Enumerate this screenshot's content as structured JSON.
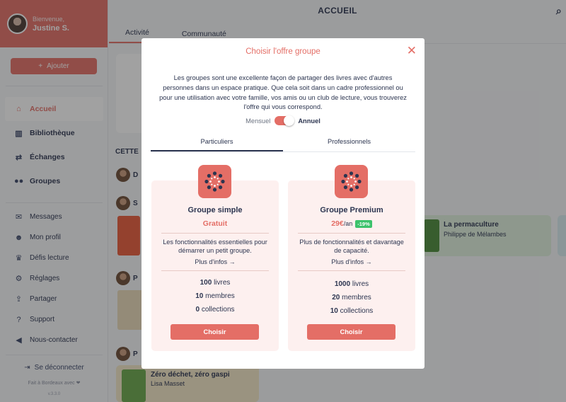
{
  "sidebar": {
    "greeting": "Bienvenue,",
    "user_name": "Justine S.",
    "add_label": "Ajouter",
    "main_items": [
      {
        "label": "Accueil",
        "icon": "home-icon",
        "active": true
      },
      {
        "label": "Bibliothèque",
        "icon": "books-icon"
      },
      {
        "label": "Échanges",
        "icon": "exchange-icon"
      },
      {
        "label": "Groupes",
        "icon": "group-icon"
      }
    ],
    "secondary_items": [
      {
        "label": "Messages",
        "icon": "mail-icon"
      },
      {
        "label": "Mon profil",
        "icon": "user-icon"
      },
      {
        "label": "Défis lecture",
        "icon": "trophy-icon"
      },
      {
        "label": "Réglages",
        "icon": "gear-icon"
      },
      {
        "label": "Partager",
        "icon": "share-icon"
      },
      {
        "label": "Support",
        "icon": "help-icon"
      },
      {
        "label": "Nous-contacter",
        "icon": "megaphone-icon"
      }
    ],
    "logout": "Se déconnecter",
    "made_in": "Fait à Bordeaux avec ❤",
    "version": "v.3.3.0"
  },
  "header": {
    "title": "ACCUEIL",
    "tabs": [
      "Activité",
      "Communauté"
    ]
  },
  "feed": {
    "section_label": "CETTE",
    "row_letters": [
      "D",
      "S",
      "P",
      "P"
    ],
    "books": [
      {
        "title": "La permaculture",
        "author": "Philippe de Mélambes"
      },
      {
        "title": "Zéro déchet, zéro gaspi",
        "author": "Lisa Masset"
      }
    ]
  },
  "modal": {
    "title": "Choisir l'offre groupe",
    "description": "Les groupes sont une excellente façon de partager des livres avec d'autres personnes dans un espace pratique. Que cela soit dans un cadre professionnel ou pour une utilisation avec votre famille, vos amis ou un club de lecture, vous trouverez l'offre qui vous correspond.",
    "toggle_off": "Mensuel",
    "toggle_on": "Annuel",
    "tabs": [
      "Particuliers",
      "Professionnels"
    ],
    "plans": [
      {
        "name": "Groupe simple",
        "price": "Gratuit",
        "per": "",
        "badge": "",
        "description": "Les fonctionnalités essentielles pour démarrer un petit groupe.",
        "more": "Plus d'infos →",
        "stats": [
          {
            "value": "100",
            "label": "livres"
          },
          {
            "value": "10",
            "label": "membres"
          },
          {
            "value": "0",
            "label": "collections"
          }
        ],
        "cta": "Choisir"
      },
      {
        "name": "Groupe Premium",
        "price": "29€",
        "per": "/an",
        "badge": "-19%",
        "description": "Plus de fonctionnalités et davantage de capacité.",
        "more": "Plus d'infos →",
        "stats": [
          {
            "value": "1000",
            "label": "livres"
          },
          {
            "value": "20",
            "label": "membres"
          },
          {
            "value": "10",
            "label": "collections"
          }
        ],
        "cta": "Choisir"
      }
    ]
  },
  "colors": {
    "accent": "#e46e66",
    "text": "#2c3550",
    "success": "#3cc26b"
  }
}
